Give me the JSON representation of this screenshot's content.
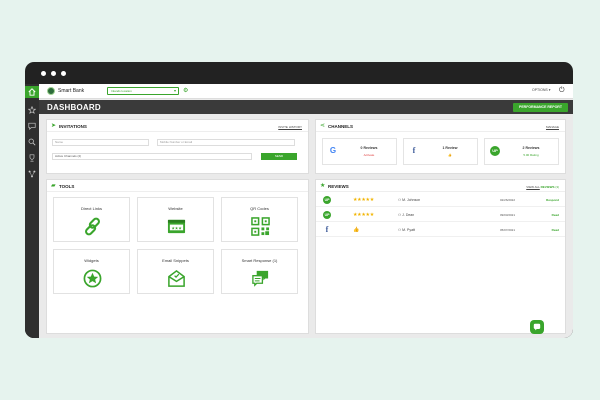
{
  "window": {
    "dots": 3
  },
  "topbar": {
    "app_name": "Smart Bank",
    "location_select": "Inlands location",
    "options_label": "OPTIONS"
  },
  "page": {
    "title": "DASHBOARD",
    "performance_button": "PERFORMANCE REPORT"
  },
  "sidebar": {
    "items": [
      {
        "icon": "home-icon",
        "active": true
      },
      {
        "icon": "star-icon",
        "active": false
      },
      {
        "icon": "message-icon",
        "active": false
      },
      {
        "icon": "search-icon",
        "active": false
      },
      {
        "icon": "trophy-icon",
        "active": false
      },
      {
        "icon": "network-icon",
        "active": false
      }
    ]
  },
  "invitations": {
    "title": "INVITATIONS",
    "history_link": "INVITE HISTORY",
    "name_placeholder": "Name",
    "contact_placeholder": "Mobile Number or Email",
    "active_channels": "Active Channels (2)",
    "send_label": "SEND"
  },
  "channels": {
    "title": "CHANNELS",
    "manage_link": "MANAGE",
    "items": [
      {
        "icon": "google-icon",
        "glyph": "G",
        "count": "0 Reviews",
        "status": "Activate",
        "status_color": "#e04040"
      },
      {
        "icon": "facebook-icon",
        "glyph": "f",
        "count": "1 Review",
        "status": "",
        "status_color": "#3aa52c"
      },
      {
        "icon": "up-icon",
        "glyph": "UP",
        "count": "2 Reviews",
        "status": "5.00 Rating",
        "status_color": "#3aa52c"
      }
    ]
  },
  "tools": {
    "title": "TOOLS",
    "items": [
      {
        "label": "Direct Links",
        "icon": "link-icon"
      },
      {
        "label": "Website",
        "icon": "website-icon"
      },
      {
        "label": "QR Codes",
        "icon": "qr-code-icon"
      },
      {
        "label": "Widgets",
        "icon": "widget-icon"
      },
      {
        "label": "Email Snippets",
        "icon": "email-icon"
      },
      {
        "label": "Smart Response (1)",
        "icon": "chat-bubbles-icon"
      }
    ]
  },
  "reviews": {
    "title": "REVIEWS",
    "view_all_link": "VIEW ALL",
    "view_all_suffix": "REVIEWS",
    "view_all_count": "(3)",
    "rows": [
      {
        "source": "up-icon",
        "glyph": "UP",
        "stars": "★★★★★",
        "name": "M. Johnson",
        "date": "02/26/2022",
        "action": "Respond"
      },
      {
        "source": "up-icon",
        "glyph": "UP",
        "stars": "★★★★★",
        "name": "J. Dean",
        "date": "09/03/2021",
        "action": "Read"
      },
      {
        "source": "facebook-icon",
        "glyph": "f",
        "stars": "",
        "name": "M. Pyatt",
        "date": "05/07/2021",
        "action": "Read"
      }
    ]
  },
  "colors": {
    "accent": "#3aa52c",
    "dark": "#2f2f2f",
    "star": "#f2b400",
    "facebook": "#3b5998",
    "google": "#4285f4"
  }
}
